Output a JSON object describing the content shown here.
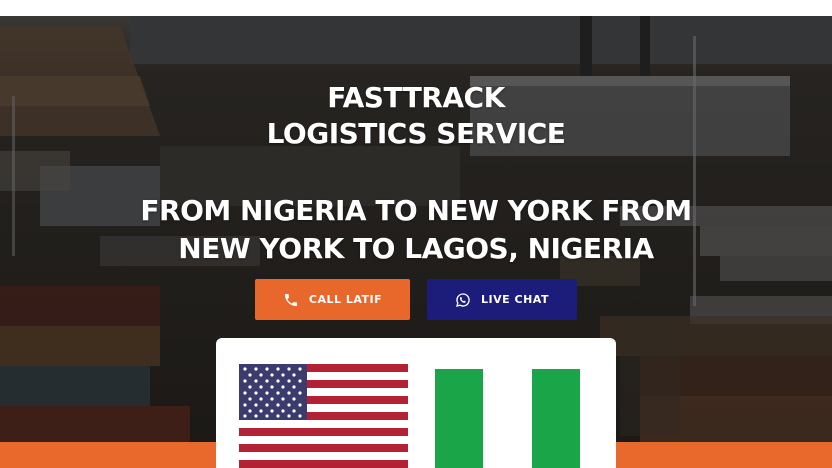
{
  "hero": {
    "title_line1": "FASTTRACK",
    "title_line2": "LOGISTICS SERVICE",
    "subtitle_line1": "FROM NIGERIA TO NEW YORK FROM",
    "subtitle_line2": "NEW YORK TO LAGOS, NIGERIA"
  },
  "buttons": {
    "call_label": "CALL LATIF",
    "chat_label": "LIVE CHAT"
  },
  "colors": {
    "accent_orange": "#e8672a",
    "accent_navy": "#1c1c7a",
    "us_red": "#b22234",
    "us_blue": "#3c3b6e",
    "ng_green": "#1aa549"
  },
  "icons": {
    "call": "phone-icon",
    "chat": "whatsapp-icon"
  }
}
